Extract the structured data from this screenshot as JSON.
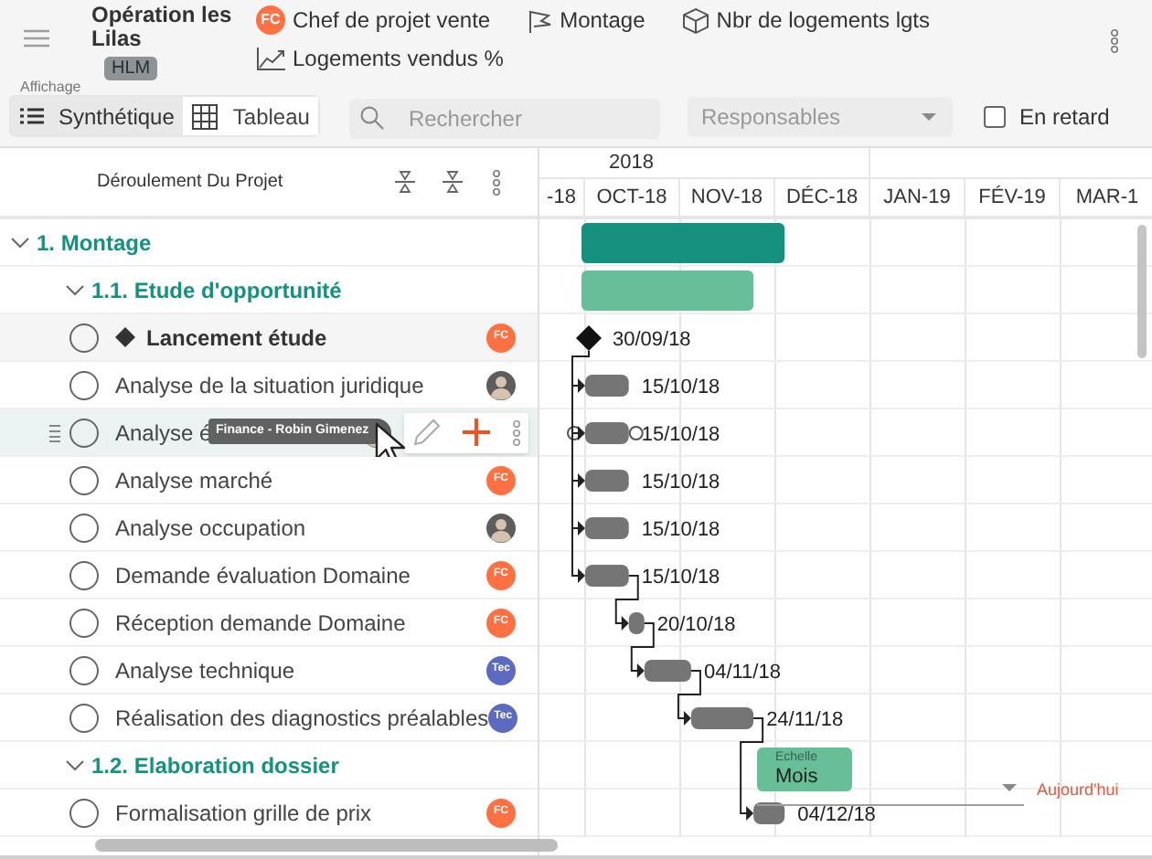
{
  "project": {
    "title": "Opération les Lilas",
    "tag": "HLM"
  },
  "indicator_rows": [
    [
      {
        "kind": "badge",
        "badge": "FC",
        "label": "Chef de projet vente"
      },
      {
        "kind": "flag",
        "label": "Montage"
      },
      {
        "kind": "cube",
        "label": "Nbr de logements lgts"
      }
    ],
    [
      {
        "kind": "chart",
        "label": "Logements vendus %"
      }
    ]
  ],
  "view": {
    "label": "Affichage",
    "options": [
      {
        "kind": "list",
        "label": "Synthétique",
        "selected": true
      },
      {
        "kind": "grid",
        "label": "Tableau",
        "selected": false
      }
    ]
  },
  "search": {
    "placeholder": "Rechercher"
  },
  "responsables": {
    "placeholder": "Responsables"
  },
  "late_filter": {
    "label": "En retard",
    "checked": false
  },
  "column_title": "Déroulement Du Projet",
  "timeline": {
    "year": "2018",
    "months": [
      "-18",
      "OCT-18",
      "NOV-18",
      "DÉC-18",
      "JAN-19",
      "FÉV-19",
      "MAR-1"
    ]
  },
  "phases": [
    {
      "label": "1. Montage",
      "expanded": true,
      "children": [
        {
          "label": "1.1. Etude d'opportunité",
          "expanded": true,
          "bar": true,
          "tasks": [
            {
              "kind": "milestone",
              "name": "Lancement étude",
              "done": false,
              "hovered": false,
              "assignee": {
                "kind": "initials",
                "initials": "FC",
                "color": "#ff7043"
              },
              "date_label": "30/09/18"
            },
            {
              "kind": "task",
              "name": "Analyse de la situation juridique",
              "done": false,
              "hovered": false,
              "assignee": {
                "kind": "photo"
              },
              "date_label": "15/10/18"
            },
            {
              "kind": "task",
              "name": "Analyse é",
              "done": false,
              "hovered": true,
              "tooltip": "Finance - Robin Gimenez",
              "assignee": {
                "kind": "photo"
              },
              "date_label": "15/10/18"
            },
            {
              "kind": "task",
              "name": "Analyse marché",
              "done": false,
              "hovered": false,
              "assignee": {
                "kind": "initials",
                "initials": "FC",
                "color": "#ff7043"
              },
              "date_label": "15/10/18"
            },
            {
              "kind": "task",
              "name": "Analyse occupation",
              "done": false,
              "hovered": false,
              "assignee": {
                "kind": "photo"
              },
              "date_label": "15/10/18"
            },
            {
              "kind": "task",
              "name": "Demande évaluation Domaine",
              "done": false,
              "hovered": false,
              "assignee": {
                "kind": "initials",
                "initials": "FC",
                "color": "#ff7043"
              },
              "date_label": "15/10/18"
            },
            {
              "kind": "task",
              "name": "Réception demande Domaine",
              "done": false,
              "hovered": false,
              "assignee": {
                "kind": "initials",
                "initials": "FC",
                "color": "#ff7043"
              },
              "date_label": "20/10/18"
            },
            {
              "kind": "task",
              "name": "Analyse technique",
              "done": false,
              "hovered": false,
              "assignee": {
                "kind": "initials",
                "initials": "Tec",
                "color": "#5c6bc0"
              },
              "date_label": "04/11/18"
            },
            {
              "kind": "task",
              "name": "Réalisation des diagnostics préalables",
              "done": false,
              "hovered": false,
              "assignee": {
                "kind": "initials",
                "initials": "Tec",
                "color": "#5c6bc0"
              },
              "date_label": "24/11/18"
            }
          ]
        },
        {
          "label": "1.2. Elaboration dossier",
          "expanded": true,
          "tasks": [
            {
              "kind": "task",
              "name": "Formalisation grille de prix",
              "done": false,
              "hovered": false,
              "assignee": {
                "kind": "initials",
                "initials": "FC",
                "color": "#ff7043"
              },
              "date_label": "04/12/18"
            }
          ]
        }
      ]
    }
  ],
  "scale": {
    "label": "Echelle",
    "value": "Mois"
  },
  "today_button": "Aujourd'hui"
}
